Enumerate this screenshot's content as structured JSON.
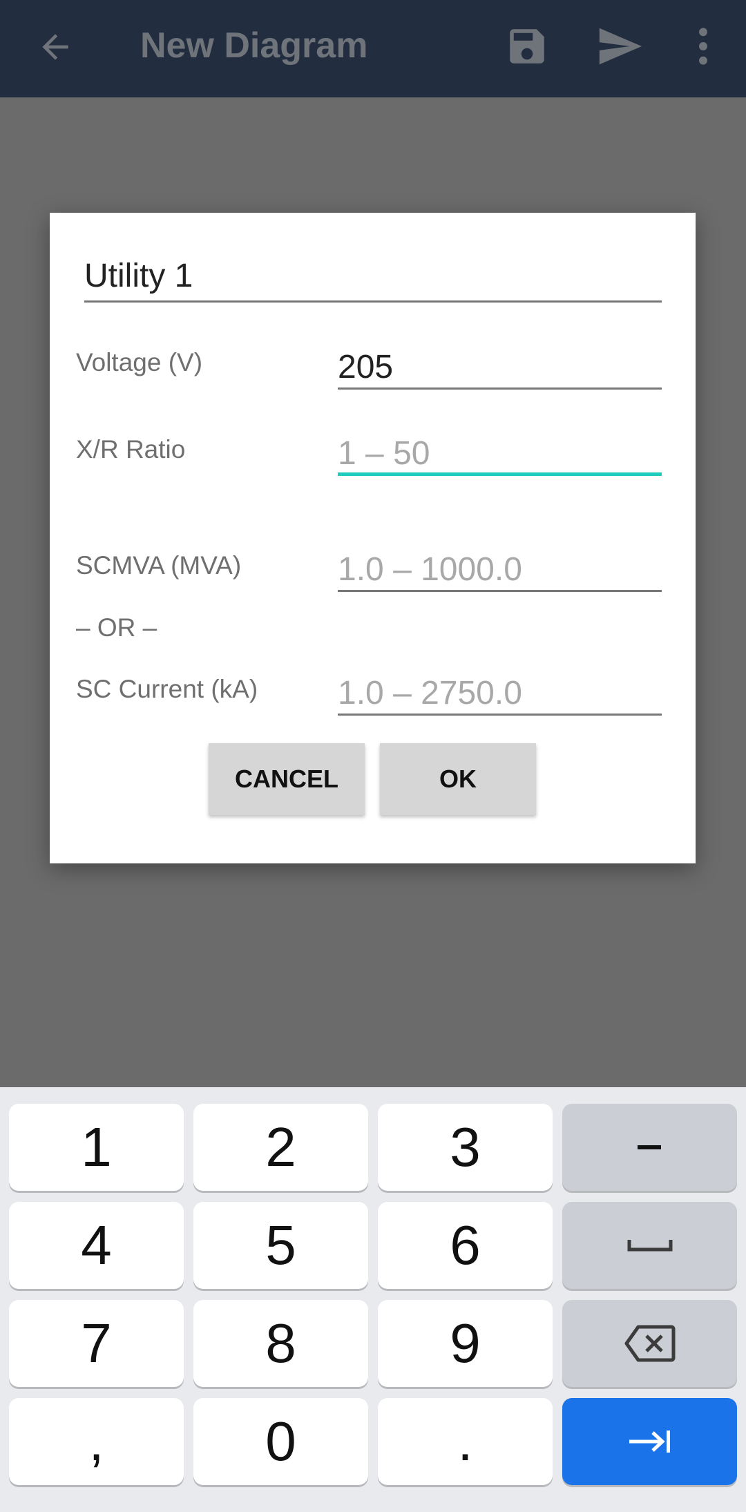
{
  "appbar": {
    "title": "New Diagram",
    "icons": [
      "arrow-back-icon",
      "save-icon",
      "send-icon",
      "more-vert-icon"
    ]
  },
  "dialog": {
    "name_value": "Utility 1",
    "fields": [
      {
        "label": "Voltage (V)",
        "value": "205",
        "placeholder": ""
      },
      {
        "label": "X/R Ratio",
        "value": "",
        "placeholder": "1 – 50"
      },
      {
        "label": "SCMVA (MVA)",
        "value": "",
        "placeholder": "1.0 – 1000.0"
      },
      {
        "label": "SC Current (kA)",
        "value": "",
        "placeholder": "1.0 – 2750.0"
      }
    ],
    "or_label": "– OR –",
    "cancel_label": "CANCEL",
    "ok_label": "OK"
  },
  "keyboard": {
    "keys": [
      "1",
      "2",
      "3",
      "−",
      "4",
      "5",
      "6",
      "space",
      "7",
      "8",
      "9",
      "backspace",
      ",",
      "0",
      ".",
      "next"
    ]
  },
  "colors": {
    "appbar": "#232d40",
    "focus": "#1ecbbd",
    "enter_key": "#1a73e8"
  }
}
